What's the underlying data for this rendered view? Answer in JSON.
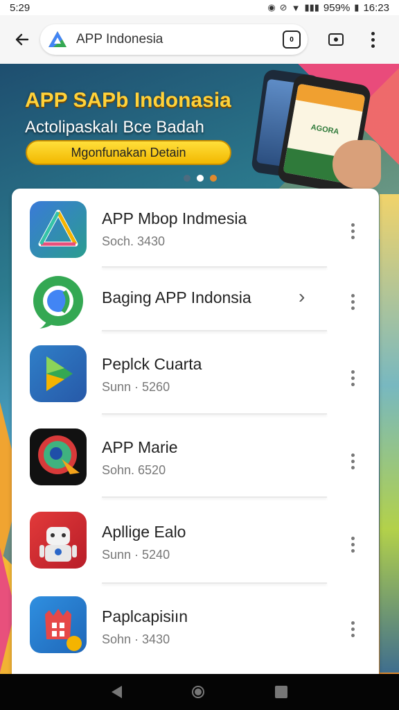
{
  "status_bar": {
    "time": "5:29",
    "battery": "959%",
    "clock": "16:23"
  },
  "browser": {
    "url_text": "APP Indonesia"
  },
  "banner": {
    "title": "APP SAPb Indonasia",
    "subtitle": "Actolipaskalı Bce Badah",
    "cta_label": "Mgonfunakan Detain",
    "phone_text": "AGORA"
  },
  "apps": [
    {
      "name": "APP Mbop Indmesia",
      "meta": "Soch. 3430",
      "icon": "tri-logo-icon"
    },
    {
      "name": "Baging APP Indonsia",
      "meta": "",
      "icon": "chrome-like-icon"
    },
    {
      "name": "Peplck Cuarta",
      "meta": "Sunn · 5260",
      "icon": "play-icon"
    },
    {
      "name": "APP Marie",
      "meta": "Sohn. 6520",
      "icon": "parrot-icon"
    },
    {
      "name": "Apllige Ealo",
      "meta": "Sunn · 5240",
      "icon": "robot-icon"
    },
    {
      "name": "Paplcapisiın",
      "meta": "Sohn · 3430",
      "icon": "castle-icon"
    }
  ],
  "colors": {
    "banner_title": "#ffd23a",
    "cta": "#f2b800"
  }
}
